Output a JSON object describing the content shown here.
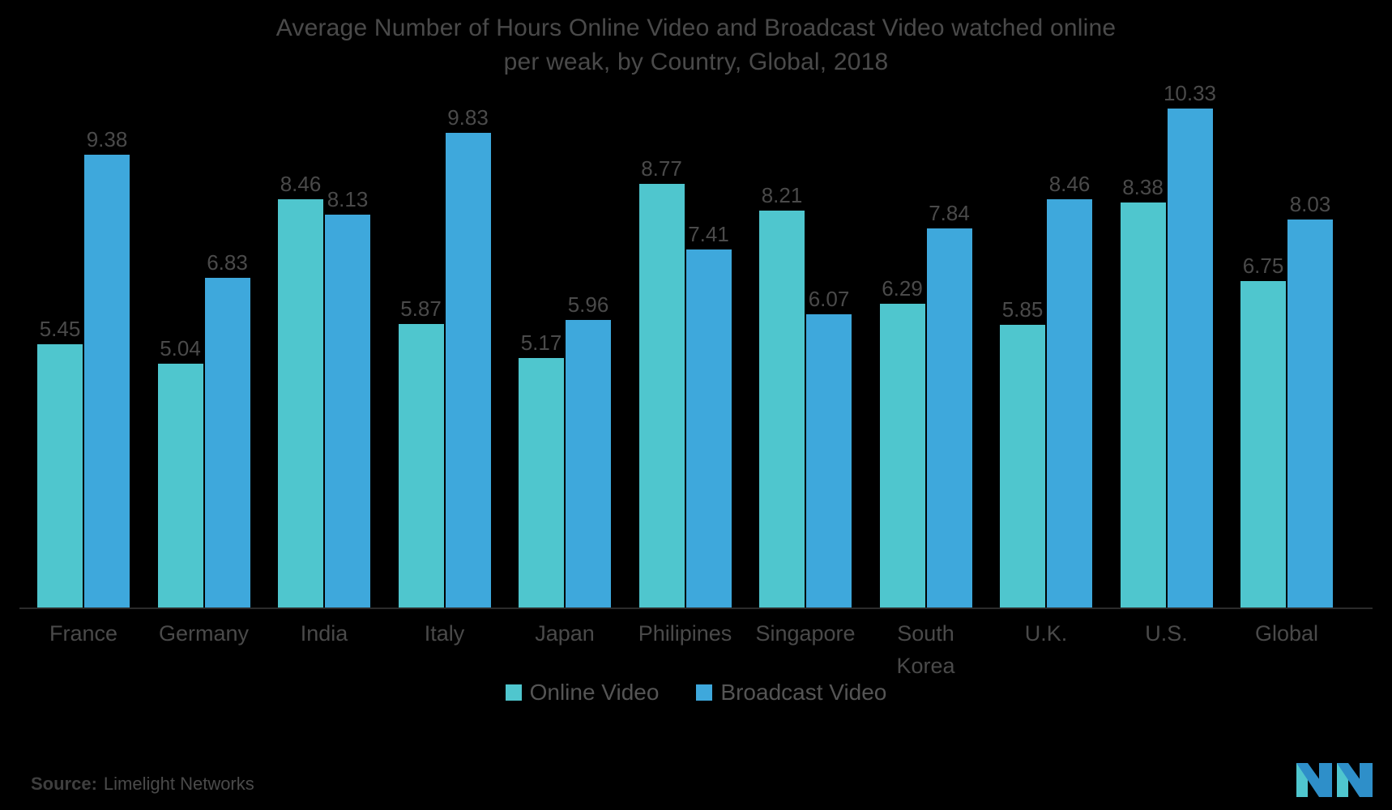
{
  "title": {
    "line1": "Average Number of Hours Online Video and Broadcast Video watched online",
    "line2": "per weak, by Country, Global, 2018"
  },
  "legend": {
    "online_label": "Online Video",
    "broadcast_label": "Broadcast Video",
    "online_color": "#4FC6CE",
    "broadcast_color": "#3EA8DC"
  },
  "source": {
    "label": "Source:",
    "value": "Limelight Networks"
  },
  "logo": {
    "name": "mordor-intelligence-logo",
    "color_blue": "#2E8FC9",
    "color_teal": "#4FC6CE"
  },
  "chart_data": {
    "type": "bar",
    "title": "Average Number of Hours Online Video and Broadcast Video watched online per weak, by Country, Global, 2018",
    "xlabel": "",
    "ylabel": "",
    "ylim": [
      0,
      10.9
    ],
    "grid": false,
    "legend_position": "bottom-center",
    "categories": [
      "France",
      "Germany",
      "India",
      "Italy",
      "Japan",
      "Philipines",
      "Singapore",
      "South\nKorea",
      "U.K.",
      "U.S.",
      "Global"
    ],
    "category_labels": [
      "France",
      "Germany",
      "India",
      "Italy",
      "Japan",
      "Philipines",
      "Singapore",
      "South Korea",
      "U.K.",
      "U.S.",
      "Global"
    ],
    "series": [
      {
        "name": "Online Video",
        "color": "#4FC6CE",
        "values": [
          5.45,
          5.04,
          8.46,
          5.87,
          5.17,
          8.77,
          8.21,
          6.29,
          5.85,
          8.38,
          6.75
        ],
        "labels": [
          "5.45",
          "5.04",
          "8.46",
          "5.87",
          "5.17",
          "8.77",
          "8.21",
          "6.29",
          "5.85",
          "8.38",
          "6.75"
        ]
      },
      {
        "name": "Broadcast Video",
        "color": "#3EA8DC",
        "values": [
          9.38,
          6.83,
          8.13,
          9.83,
          5.96,
          7.41,
          6.07,
          7.84,
          8.46,
          10.33,
          8.03
        ],
        "labels": [
          "9.38",
          "6.83",
          "8.13",
          "9.83",
          "5.96",
          "7.41",
          "6.07",
          "7.84",
          "8.46",
          "10.33",
          "8.03"
        ]
      }
    ]
  }
}
